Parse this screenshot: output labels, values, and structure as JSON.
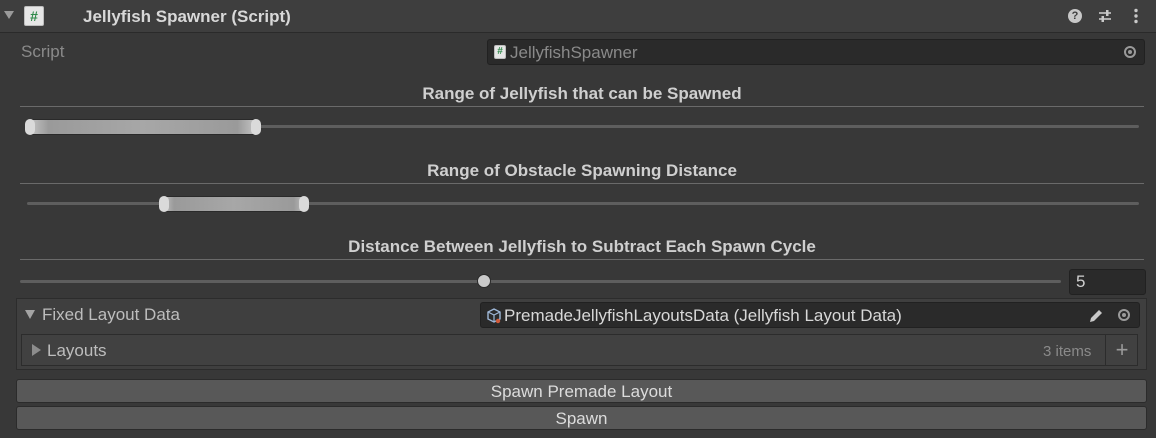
{
  "header": {
    "title": "Jellyfish Spawner (Script)",
    "script_glyph": "#",
    "help_glyph": "?"
  },
  "script_field": {
    "label": "Script",
    "value": "JellyfishSpawner"
  },
  "sections": [
    {
      "title": "Range of Jellyfish that can be Spawned",
      "slider_min": 0.0,
      "slider_max": 0.21
    },
    {
      "title": "Range of Obstacle Spawning Distance",
      "slider_min": 0.125,
      "slider_max": 0.255
    },
    {
      "title": "Distance Between Jellyfish to Subtract Each Spawn Cycle",
      "slider_fraction": 0.45,
      "value": "5"
    }
  ],
  "fixed_layout": {
    "label": "Fixed Layout Data",
    "value": "PremadeJellyfishLayoutsData (Jellyfish Layout Data)",
    "layouts_label": "Layouts",
    "layouts_count": "3 items",
    "add_glyph": "+"
  },
  "buttons": {
    "spawn_premade": "Spawn Premade Layout",
    "spawn": "Spawn"
  },
  "colors": {
    "background": "#383838",
    "header": "#3e3e3e",
    "button": "#585858",
    "script_icon_green": "#2f8a4a"
  }
}
